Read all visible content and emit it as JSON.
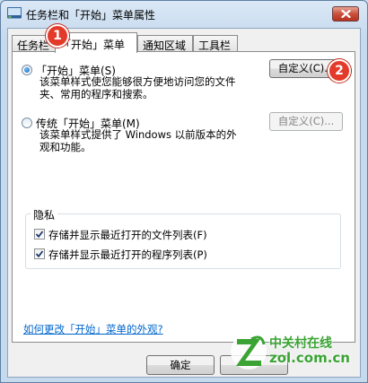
{
  "window": {
    "title": "任务栏和「开始」菜单属性"
  },
  "tabs": [
    {
      "label": "任务栏"
    },
    {
      "label": "「开始」菜单"
    },
    {
      "label": "通知区域"
    },
    {
      "label": "工具栏"
    }
  ],
  "options": {
    "start_menu": {
      "label": "「开始」菜单(S)",
      "desc": "该菜单样式使您能够很方便地访问您的文件夹、常用的程序和搜索。",
      "customize": "自定义(C)..."
    },
    "classic_menu": {
      "label": "传统「开始」菜单(M)",
      "desc": "该菜单样式提供了 Windows 以前版本的外观和功能。",
      "customize": "自定义(C)..."
    }
  },
  "privacy": {
    "title": "隐私",
    "items": [
      {
        "label": "存储并显示最近打开的文件列表(F)"
      },
      {
        "label": "存储并显示最近打开的程序列表(P)"
      }
    ]
  },
  "help_link": "如何更改「开始」菜单的外观?",
  "buttons": {
    "ok": "确定"
  },
  "callouts": [
    "1",
    "2"
  ],
  "watermark": {
    "brand": "中关村在线",
    "domain": "zol.com.cn"
  },
  "colors": {
    "accent": "#1a5fa8",
    "link": "#0066cc",
    "callout": "#e33a2a",
    "watermark": "#3aa334"
  }
}
